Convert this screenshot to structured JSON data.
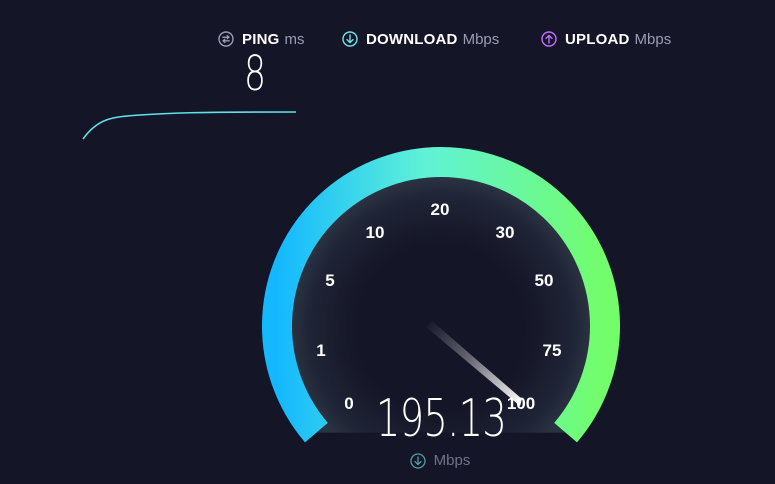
{
  "metrics": {
    "ping": {
      "label": "PING",
      "unit": "ms",
      "value": "8",
      "icon": "ping-icon",
      "icon_color": "#9a9cb3"
    },
    "download": {
      "label": "DOWNLOAD",
      "unit": "Mbps",
      "icon": "download-arrow-icon",
      "icon_color": "#6fe3e8"
    },
    "upload": {
      "label": "UPLOAD",
      "unit": "Mbps",
      "icon": "upload-arrow-icon",
      "icon_color": "#bf71ff"
    }
  },
  "gauge": {
    "ticks": [
      "0",
      "1",
      "5",
      "10",
      "20",
      "30",
      "50",
      "75",
      "100"
    ],
    "current_value": "195.13",
    "unit": "Mbps",
    "unit_icon": "download-arrow-icon",
    "needle_position": "100",
    "colors": {
      "start": "#14b8ff",
      "middle": "#5ff2d6",
      "end": "#73fd6a",
      "background": "#141526"
    }
  }
}
